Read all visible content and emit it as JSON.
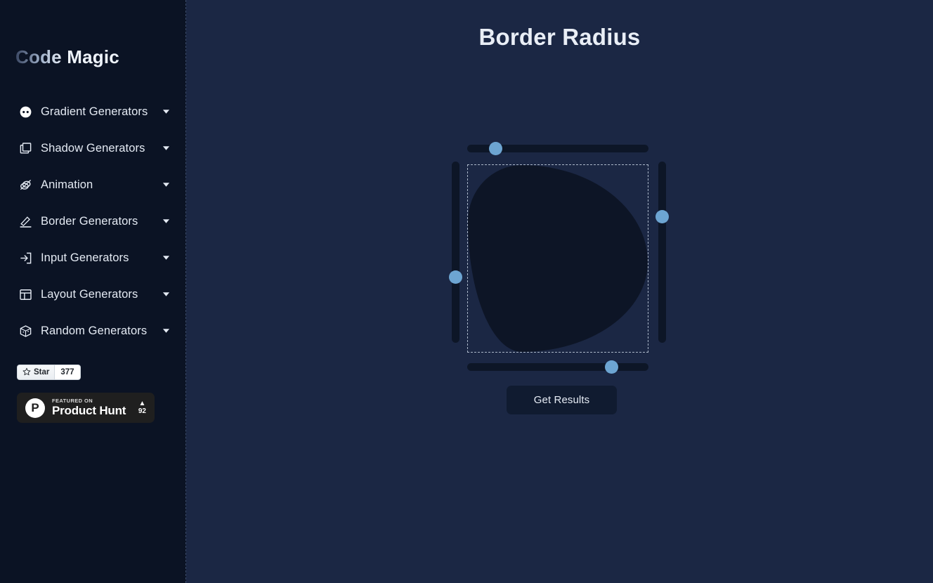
{
  "sidebar": {
    "logo": {
      "dim_part": "Code",
      "bright_part": " Magic"
    },
    "items": [
      {
        "label": "Gradient Generators",
        "icon": "gradient-circle-icon",
        "caret": "chevron-down-icon"
      },
      {
        "label": "Shadow Generators",
        "icon": "square-shadow-icon",
        "caret": "chevron-down-icon"
      },
      {
        "label": "Animation",
        "icon": "animation-rings-icon",
        "caret": "chevron-down-icon"
      },
      {
        "label": "Border Generators",
        "icon": "pencil-underline-icon",
        "caret": "chevron-down-icon"
      },
      {
        "label": "Input Generators",
        "icon": "login-arrow-icon",
        "caret": "chevron-down-icon"
      },
      {
        "label": "Layout Generators",
        "icon": "layout-grid-icon",
        "caret": "chevron-down-icon"
      },
      {
        "label": "Random Generators",
        "icon": "dice-cube-icon",
        "caret": "chevron-down-icon"
      }
    ],
    "github": {
      "icon": "star-icon",
      "label": "Star",
      "count": "377"
    },
    "product_hunt": {
      "logo_letter": "P",
      "subtitle": "FEATURED ON",
      "title": "Product Hunt",
      "arrow": "▲",
      "votes": "92"
    }
  },
  "main": {
    "title": "Border Radius",
    "get_results_label": "Get Results",
    "sliders": {
      "top": {
        "name": "top-radius-slider",
        "percent": 13
      },
      "right": {
        "name": "right-radius-slider",
        "percent": 29
      },
      "bottom": {
        "name": "bottom-radius-slider",
        "percent": 82
      },
      "left": {
        "name": "left-radius-slider",
        "percent": 65
      }
    },
    "preview": {
      "border_radius": "30% 70% 70% 30% / 30% 52% 48% 70%"
    }
  },
  "colors": {
    "sidebar_bg": "#0b1324",
    "main_bg": "#1b2744",
    "shape_fill": "#0d1526",
    "slider_track": "#0d1627",
    "slider_thumb": "#6da5d2",
    "text": "#e4eaf3",
    "button_bg": "#101b30"
  }
}
